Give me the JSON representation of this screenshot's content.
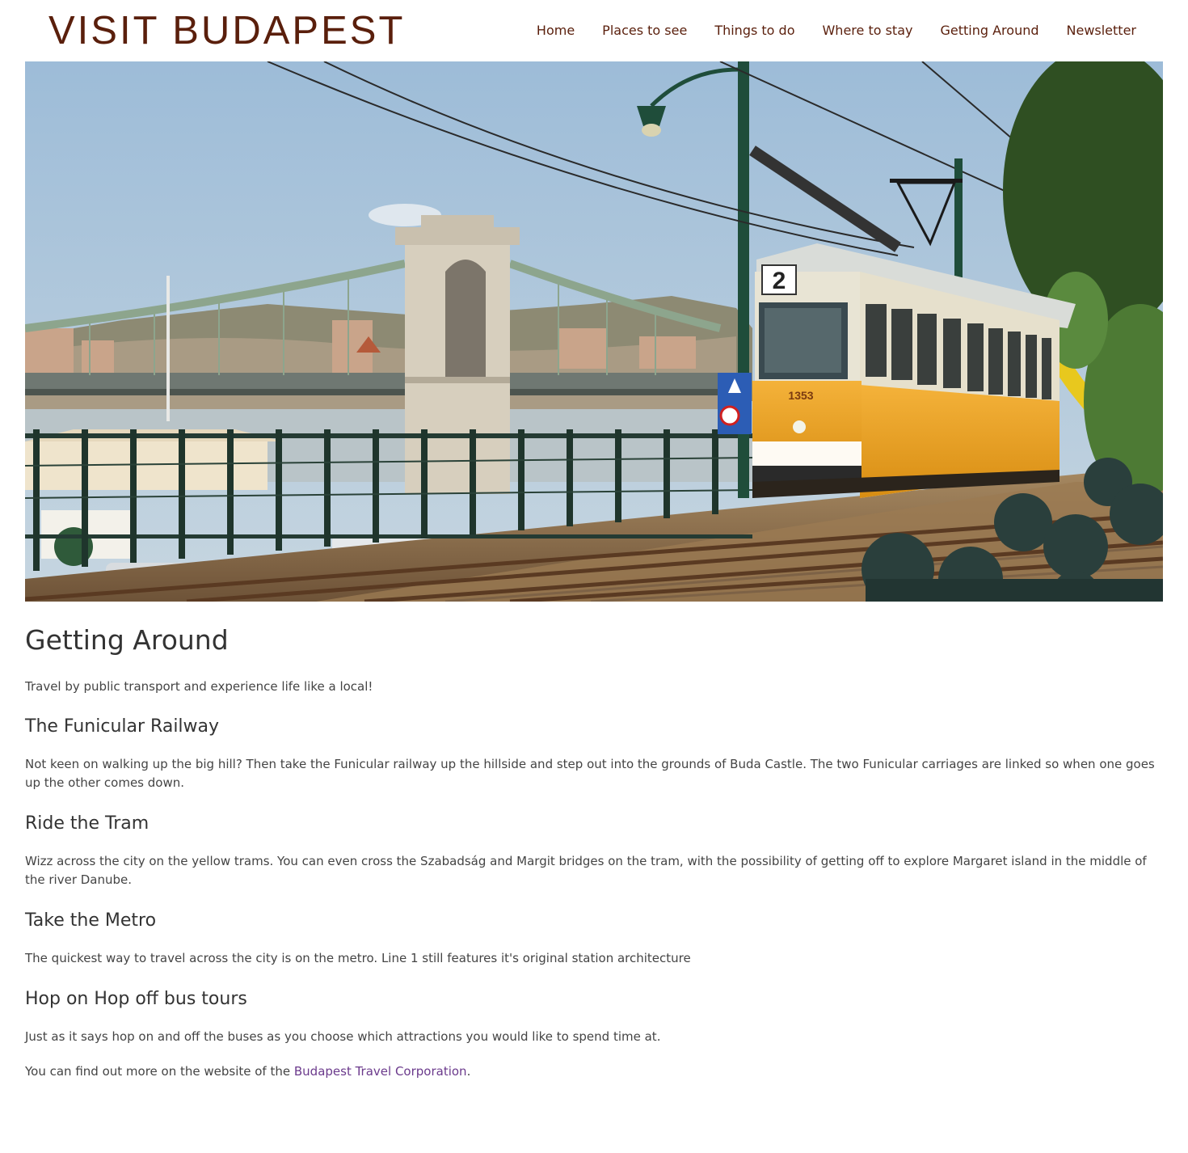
{
  "header": {
    "logo_text": "VISIT BUDAPEST",
    "nav": [
      {
        "label": "Home"
      },
      {
        "label": "Places to see"
      },
      {
        "label": "Things to do"
      },
      {
        "label": "Where to stay"
      },
      {
        "label": "Getting Around"
      },
      {
        "label": "Newsletter"
      }
    ]
  },
  "hero": {
    "tram_route_number": "2",
    "tram_fleet_number": "1353"
  },
  "main": {
    "title": "Getting Around",
    "lead": "Travel by public transport and experience life like a local!",
    "sections": [
      {
        "heading": "The Funicular Railway",
        "text": "Not keen on walking up the big hill? Then take the Funicular railway up the hillside and step out into the grounds of Buda Castle. The two Funicular carriages are linked so when one goes up the other comes down."
      },
      {
        "heading": "Ride the Tram",
        "text": "Wizz across the city on the yellow trams. You can even cross the Szabadság and Margit bridges on the tram, with the possibility of getting off to explore Margaret island in the middle of the river Danube."
      },
      {
        "heading": "Take the Metro",
        "text": "The quickest way to travel across the city is on the metro. Line 1 still features it's original station architecture"
      },
      {
        "heading": "Hop on Hop off bus tours",
        "text": "Just as it says hop on and off the buses as you choose which attractions you would like to spend time at."
      }
    ],
    "footer_note": {
      "prefix": "You can find out more on the website of the ",
      "link_text": "Budapest Travel Corporation",
      "suffix": "."
    }
  },
  "colors": {
    "brand": "#5a1f0c",
    "link": "#6b3a8c",
    "text": "#444444",
    "tram_yellow": "#f0a21e"
  }
}
